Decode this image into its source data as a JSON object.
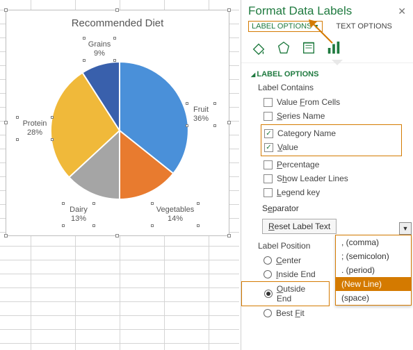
{
  "panel_title": "Format Data Labels",
  "tabs": {
    "label_options": "LABEL OPTIONS",
    "text_options": "TEXT OPTIONS"
  },
  "icons": {
    "fill": "fill-bucket-icon",
    "effects": "effects-icon",
    "size": "size-props-icon",
    "chart": "chart-bars-icon"
  },
  "section": "LABEL OPTIONS",
  "label_contains": {
    "title": "Label Contains",
    "value_from_cells": "Value From Cells",
    "series_name": "Series Name",
    "category_name": "Category Name",
    "value": "Value",
    "percentage": "Percentage",
    "show_leader": "Show Leader Lines",
    "legend_key": "Legend key"
  },
  "separator_label": "Separator",
  "reset_label": "Reset Label Text",
  "label_position": {
    "title": "Label Position",
    "center": "Center",
    "inside_end": "Inside End",
    "outside_end": "Outside End",
    "best_fit": "Best Fit"
  },
  "dropdown": {
    "comma": ", (comma)",
    "semicolon": "; (semicolon)",
    "period": ". (period)",
    "newline": "(New Line)",
    "space": "  (space)"
  },
  "chart_data": {
    "type": "pie",
    "title": "Recommended Diet",
    "categories": [
      "Fruit",
      "Vegetables",
      "Dairy",
      "Protein",
      "Grains"
    ],
    "values": [
      36,
      14,
      13,
      28,
      9
    ],
    "label_format": "category_name + value_percent",
    "label_position": "Outside End",
    "colors": [
      "#4a90d9",
      "#e87b2f",
      "#a5a5a5",
      "#f0b93a",
      "#3960ac"
    ]
  },
  "labels": {
    "fruit": {
      "l1": "Fruit",
      "l2": "36%"
    },
    "veg": {
      "l1": "Vegetables",
      "l2": "14%"
    },
    "dairy": {
      "l1": "Dairy",
      "l2": "13%"
    },
    "protein": {
      "l1": "Protein",
      "l2": "28%"
    },
    "grains": {
      "l1": "Grains",
      "l2": "9%"
    }
  }
}
